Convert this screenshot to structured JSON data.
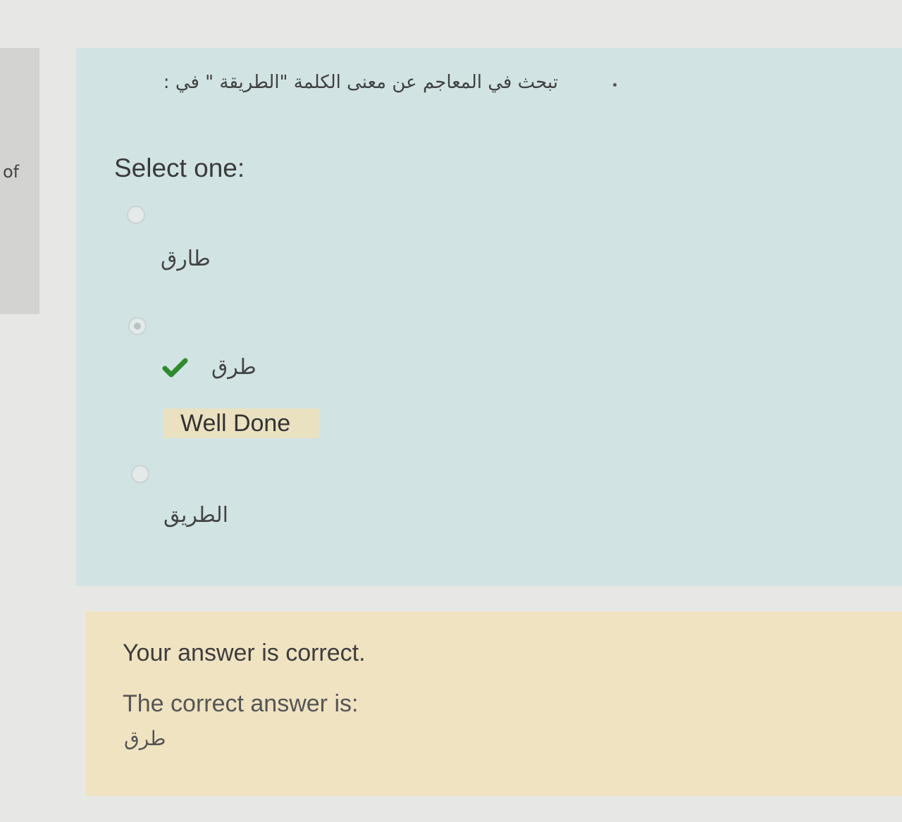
{
  "sidebar": {
    "info_text": "of"
  },
  "question": {
    "text": "تبحث في المعاجم عن معنى الكلمة \"الطريقة \" في :",
    "prompt": "Select one:",
    "options": [
      {
        "label": "طارق",
        "selected": false
      },
      {
        "label": "طرق",
        "selected": true,
        "correct": true,
        "feedback": "Well Done"
      },
      {
        "label": "الطريق",
        "selected": false
      }
    ]
  },
  "result": {
    "status": "Your answer is correct.",
    "correct_label": "The correct answer is:",
    "correct_value": "طرق"
  },
  "colors": {
    "question_bg": "#d2e3e4",
    "result_bg": "#efe3c2",
    "feedback_bg": "#e9e1c0",
    "check_green": "#2e8a2e"
  },
  "icons": {
    "correct": "check-icon"
  }
}
